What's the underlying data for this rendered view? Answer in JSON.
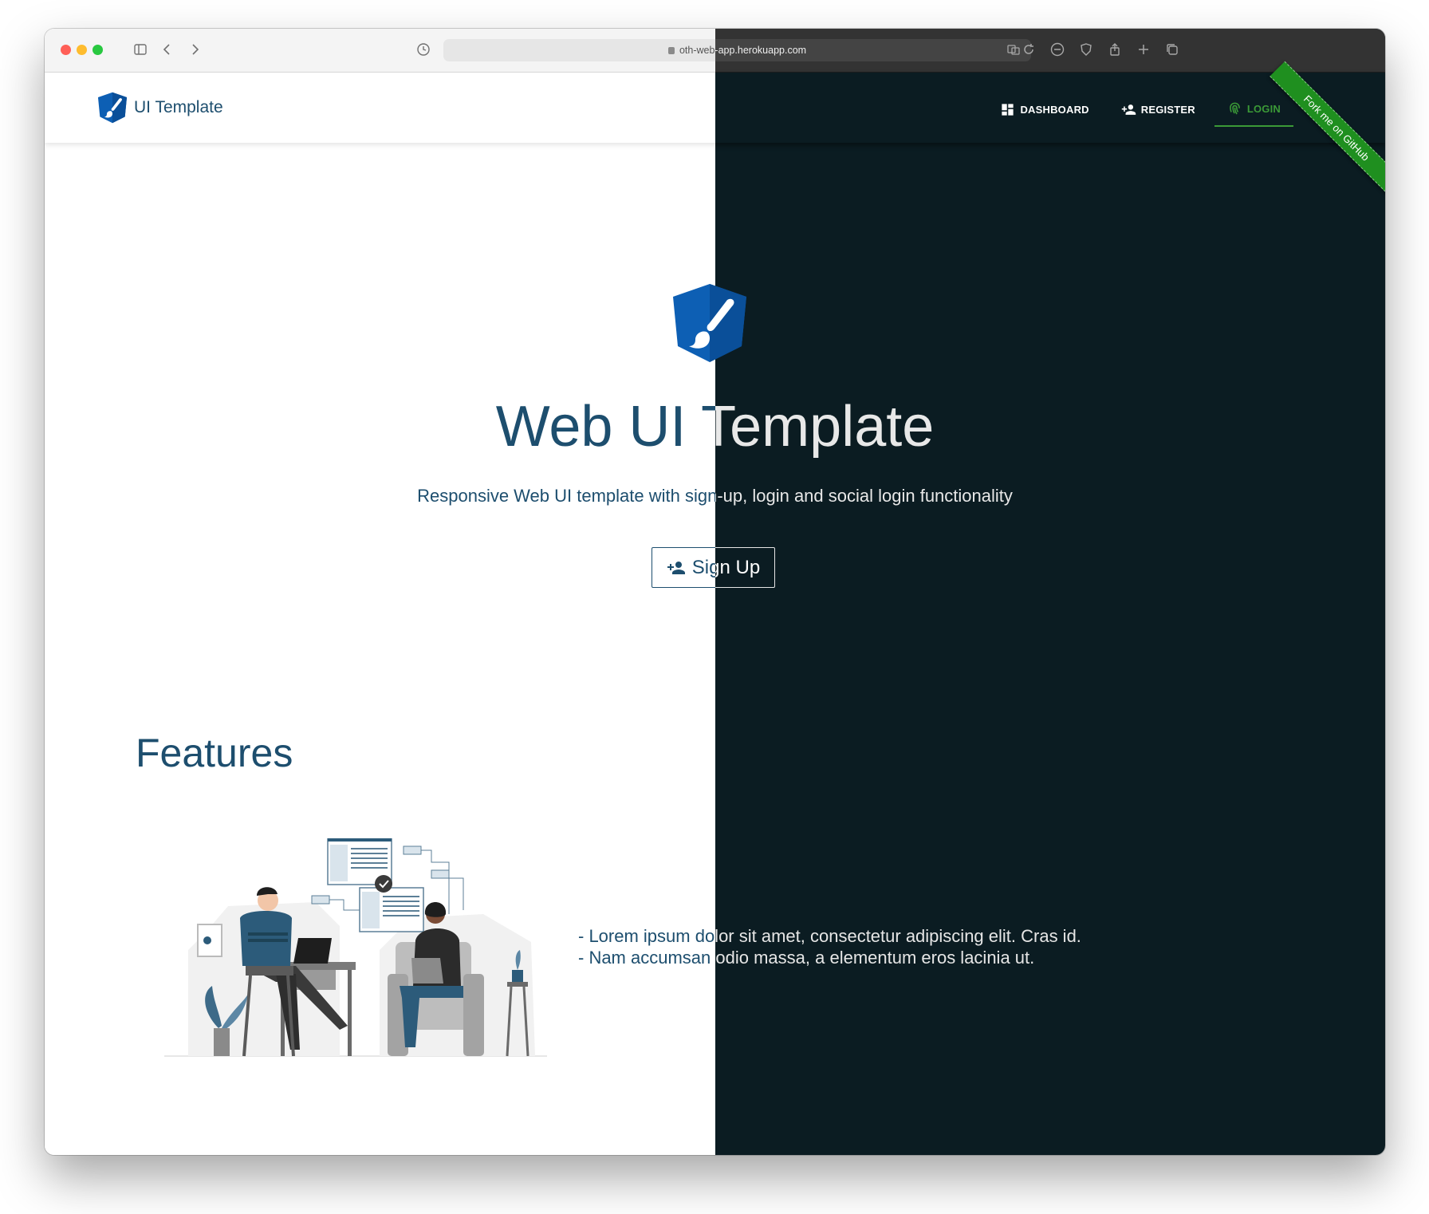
{
  "browser": {
    "url": "oth-web-app.herokuapp.com"
  },
  "header": {
    "brand": "UI Template",
    "nav": [
      {
        "label": "DASHBOARD",
        "icon": "dashboard-icon"
      },
      {
        "label": "REGISTER",
        "icon": "person-add-icon"
      },
      {
        "label": "LOGIN",
        "icon": "fingerprint-icon",
        "active": true
      }
    ],
    "ribbon": "Fork me on GitHub"
  },
  "hero": {
    "title": "Web UI Template",
    "subtitle": "Responsive Web UI template with sign-up, login and social login functionality",
    "signup_label": "Sign Up"
  },
  "features": {
    "title": "Features",
    "items": [
      "- Lorem ipsum dolor sit amet, consectetur adipiscing elit. Cras id.",
      "- Nam accumsan odio massa, a elementum eros lacinia ut."
    ]
  },
  "colors": {
    "light_text": "#1d4e6e",
    "dark_background": "#0b1c22",
    "accent_green": "#3b9a37",
    "logo_blue": "#0d5fb4"
  }
}
